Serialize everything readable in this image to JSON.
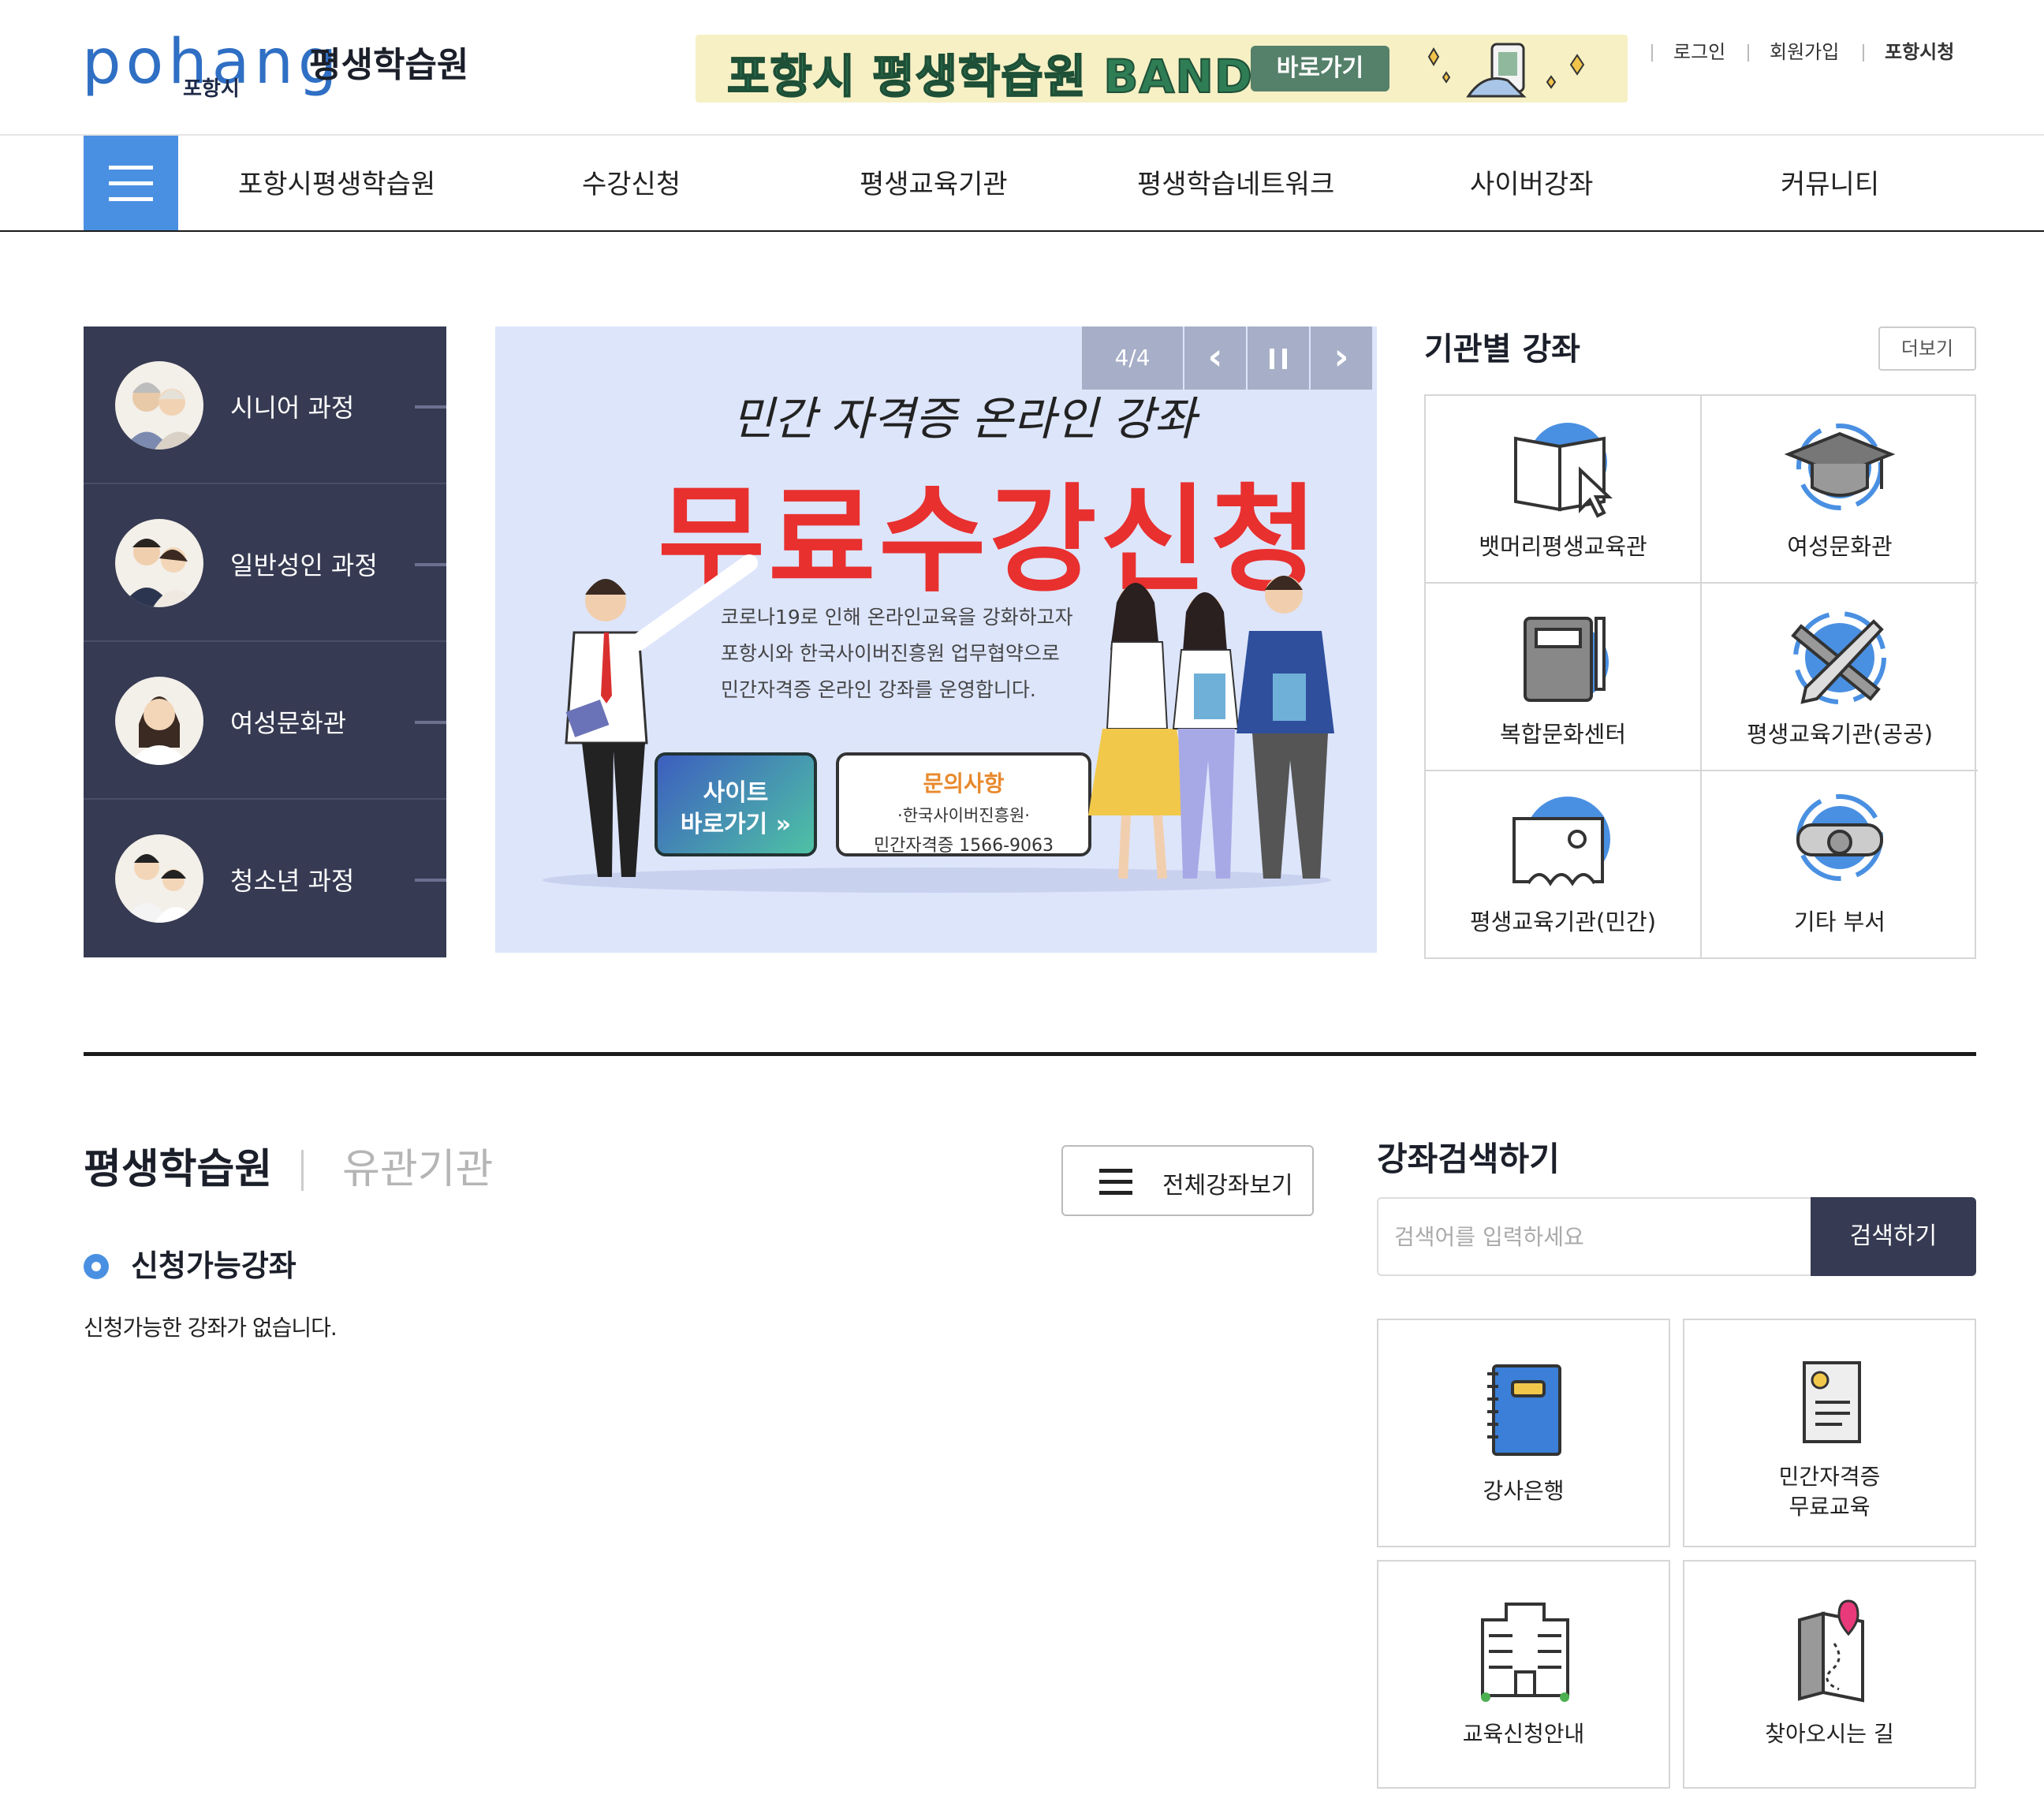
{
  "header": {
    "logo_word": "pohang",
    "logo_sub": "포항시",
    "logo_title": "평생학습원",
    "band_banner": {
      "text": "포항시 평생학습원 BAND",
      "button": "바로가기"
    },
    "links": [
      "로그인",
      "회원가입",
      "포항시청"
    ]
  },
  "nav": {
    "menu_icon": "hamburger-icon",
    "items": [
      "포항시평생학습원",
      "수강신청",
      "평생교육기관",
      "평생학습네트워크",
      "사이버강좌",
      "커뮤니티"
    ]
  },
  "courses": [
    {
      "label": "시니어 과정",
      "icon": "senior-avatar"
    },
    {
      "label": "일반성인 과정",
      "icon": "adult-avatar"
    },
    {
      "label": "여성문화관",
      "icon": "woman-avatar"
    },
    {
      "label": "청소년 과정",
      "icon": "youth-avatar"
    }
  ],
  "banner": {
    "counter": "4/4",
    "subtitle": "민간 자격증 온라인 강좌",
    "headline": "무료수강신청",
    "description": [
      "코로나19로 인해 온라인교육을 강화하고자",
      "포항시와 한국사이버진흥원 업무협약으로",
      "민간자격증 온라인 강좌를 운영합니다."
    ],
    "site_button": [
      "사이트",
      "바로가기 »"
    ],
    "contact": {
      "title": "문의사항",
      "org": "·한국사이버진흥원·",
      "phone": "민간자격증 1566-9063"
    }
  },
  "institutions": {
    "title": "기관별 강좌",
    "more": "더보기",
    "items": [
      {
        "label": "뱃머리평생교육관",
        "icon": "book-cursor-icon"
      },
      {
        "label": "여성문화관",
        "icon": "graduation-cap-icon"
      },
      {
        "label": "복합문화센터",
        "icon": "notebook-pen-icon"
      },
      {
        "label": "평생교육기관(공공)",
        "icon": "pencil-ruler-icon"
      },
      {
        "label": "평생교육기관(민간)",
        "icon": "lecture-board-icon"
      },
      {
        "label": "기타 부서",
        "icon": "diploma-scroll-icon"
      }
    ]
  },
  "tabs": {
    "active": "평생학습원",
    "inactive": "유관기관"
  },
  "all_courses_button": "전체강좌보기",
  "available": {
    "title": "신청가능강좌",
    "empty": "신청가능한 강좌가 없습니다."
  },
  "search": {
    "title": "강좌검색하기",
    "placeholder": "검색어를 입력하세요",
    "button": "검색하기"
  },
  "quick_links": [
    {
      "label": "강사은행",
      "icon": "notebook-icon"
    },
    {
      "label": "민간자격증\n무료교육",
      "icon": "certificate-icon"
    },
    {
      "label": "교육신청안내",
      "icon": "building-icon"
    },
    {
      "label": "찾아오시는 길",
      "icon": "map-pin-icon"
    }
  ],
  "colors": {
    "accent": "#4a90e2",
    "navy": "#363a52",
    "headline_red": "#e8302f",
    "banner_bg": "#dde5fb"
  }
}
